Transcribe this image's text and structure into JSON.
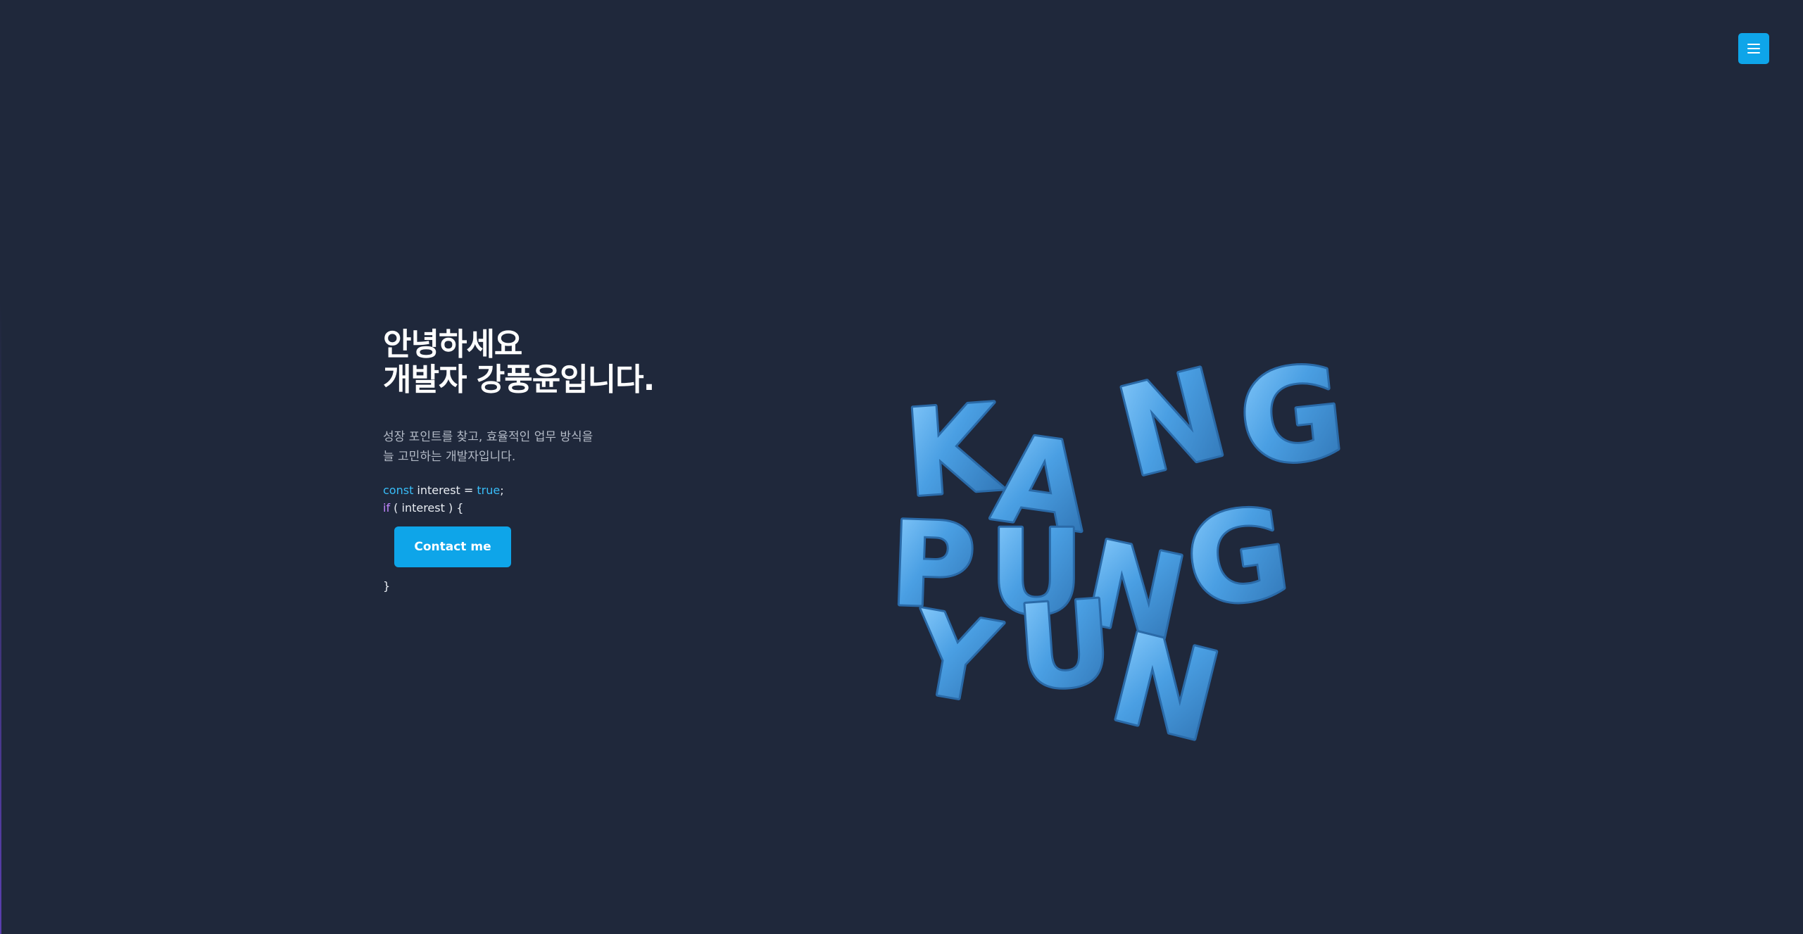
{
  "header": {
    "menu_icon": "hamburger-menu-icon"
  },
  "hero": {
    "title_line1": "안녕하세요",
    "title_line2": "개발자 강풍윤입니다.",
    "intro_line1": "성장 포인트를 찾고, 효율적인 업무 방식을",
    "intro_line2": "늘 고민하는 개발자입니다.",
    "code": {
      "const_kw": "const",
      "var_decl": " interest = ",
      "true_kw": "true",
      "semicolon": ";",
      "if_kw": "if",
      "if_cond": " ( interest ) {",
      "closing": "}"
    },
    "contact_label": "Contact me"
  },
  "art": {
    "words": [
      "KANG",
      "PUNG",
      "YUN"
    ],
    "balloon_color": "#4a9fe3",
    "balloon_highlight": "#8fd0ff",
    "balloon_shadow": "#2d6fae"
  },
  "colors": {
    "background": "#1f283b",
    "accent": "#0ea5e9",
    "keyword": "#38bdf8",
    "keyword_if": "#c084fc",
    "muted_text": "#b3bac6"
  }
}
